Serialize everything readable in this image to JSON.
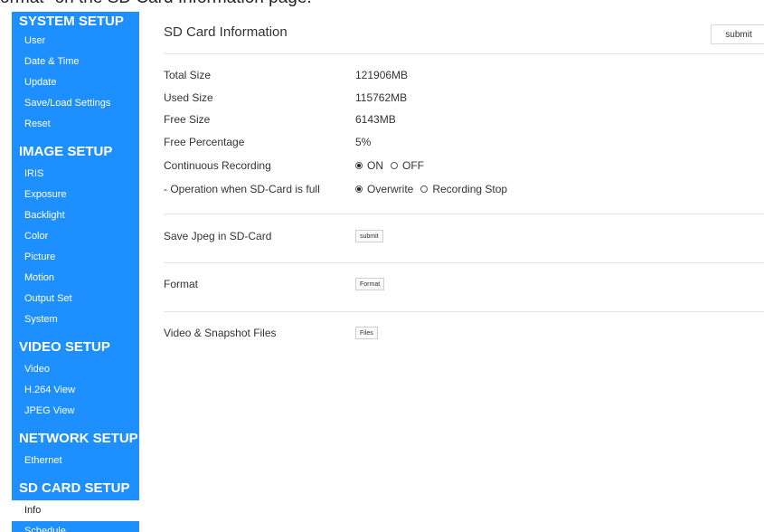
{
  "caption": "ormat\" on the SD Card Information page.",
  "sidebar": {
    "sections": [
      {
        "title": "SYSTEM SETUP",
        "items": [
          "User",
          "Date & Time",
          "Update",
          "Save/Load Settings",
          "Reset"
        ]
      },
      {
        "title": "IMAGE SETUP",
        "items": [
          "IRIS",
          "Exposure",
          "Backlight",
          "Color",
          "Picture",
          "Motion",
          "Output Set",
          "System"
        ]
      },
      {
        "title": "VIDEO SETUP",
        "items": [
          "Video",
          "H.264 View",
          "JPEG View"
        ]
      },
      {
        "title": "NETWORK SETUP",
        "items": [
          "Ethernet"
        ]
      },
      {
        "title": "SD CARD SETUP",
        "items": [
          "Info",
          "Schedule"
        ]
      }
    ],
    "active_item": "Info"
  },
  "main": {
    "title": "SD Card Information",
    "top_submit": "submit",
    "info": {
      "total_size_label": "Total Size",
      "total_size": "121906MB",
      "used_size_label": "Used Size",
      "used_size": "115762MB",
      "free_size_label": "Free Size",
      "free_size": "6143MB",
      "free_pct_label": "Free Percentage",
      "free_pct": "5%"
    },
    "continuous": {
      "label": "Continuous Recording",
      "on": "ON",
      "off": "OFF",
      "selected": "ON"
    },
    "full": {
      "label": "- Operation when SD-Card is full",
      "overwrite": "Overwrite",
      "stop": "Recording Stop",
      "selected": "Overwrite"
    },
    "jpeg": {
      "label": "Save Jpeg in SD-Card",
      "button": "submit"
    },
    "format": {
      "label": "Format",
      "button": "Format"
    },
    "files": {
      "label": "Video & Snapshot Files",
      "button": "Files"
    }
  }
}
